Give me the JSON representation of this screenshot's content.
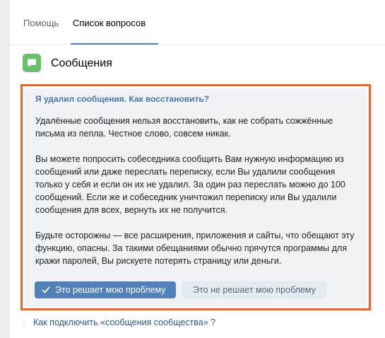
{
  "tabs": [
    {
      "label": "Помощь",
      "active": false
    },
    {
      "label": "Список вопросов",
      "active": true
    }
  ],
  "section": {
    "icon": "message-bubble-icon",
    "icon_color": "#6cbf6a",
    "title": "Сообщения"
  },
  "question": {
    "title": "Я удалил сообщения. Как восстановить?",
    "paragraphs": [
      [
        "Удалённые сообщения нельзя восстановить, как не собрать сожжённые",
        "письма из пепла. Честное слово, совсем никак."
      ],
      [
        "Вы можете попросить собеседника сообщить Вам нужную информацию из",
        "сообщений или даже переслать переписку, если Вы удалили сообщения",
        "только у себя и если он их не удалил. За один раз переслать можно до 100",
        "сообщений. Если же и собеседник уничтожил переписку или Вы удалили",
        "сообщения для всех, вернуть их не получится."
      ],
      [
        "Будьте осторожны — все расширения, приложения и сайты, что обещают эту",
        "функцию, опасны. За такими обещаниями обычно прячутся программы для",
        "кражи паролей, Вы рискуете потерять страницу или деньги."
      ]
    ],
    "buttons": {
      "solves": "Это решает мою проблему",
      "not_solves": "Это не решает мою проблему"
    }
  },
  "related": {
    "bullet": "·",
    "link": "Как подключить «сообщения сообщества» ?"
  },
  "colors": {
    "accent": "#5181b8",
    "highlight_frame": "#f7631d",
    "link": "#2a5885"
  }
}
